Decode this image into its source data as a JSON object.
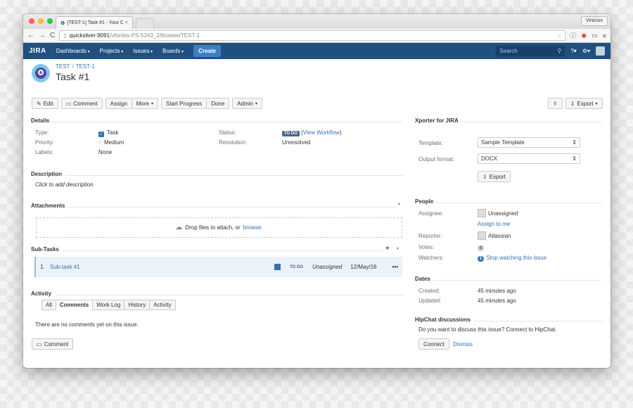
{
  "browser": {
    "tab_title": "[TEST-1] Task #1 - Your C",
    "user": "Vinicius",
    "url_host": "quicksilver:9091",
    "url_path": "/vfontes-PS-5243_2/browse/TEST-1"
  },
  "nav": {
    "logo": "JIRA",
    "items": [
      "Dashboards",
      "Projects",
      "Issues",
      "Boards"
    ],
    "create": "Create",
    "search_placeholder": "Search"
  },
  "issue": {
    "project": "TEST",
    "key": "TEST-1",
    "summary": "Task #1"
  },
  "actions": {
    "edit": "Edit",
    "comment": "Comment",
    "assign": "Assign",
    "more": "More",
    "start_progress": "Start Progress",
    "done": "Done",
    "admin": "Admin",
    "export": "Export"
  },
  "details": {
    "heading": "Details",
    "type_label": "Type:",
    "type_value": "Task",
    "priority_label": "Priority:",
    "priority_value": "Medium",
    "labels_label": "Labels:",
    "labels_value": "None",
    "status_label": "Status:",
    "status_value": "TO DO",
    "view_workflow": "View Workflow",
    "resolution_label": "Resolution:",
    "resolution_value": "Unresolved"
  },
  "description": {
    "heading": "Description",
    "placeholder": "Click to add description"
  },
  "attachments": {
    "heading": "Attachments",
    "drop_text": "Drop files to attach, or",
    "browse": "browse."
  },
  "subtasks": {
    "heading": "Sub-Tasks",
    "rows": [
      {
        "num": "1.",
        "title": "Sub-task #1",
        "status": "TO DO",
        "assignee": "Unassigned",
        "date": "12/May/16"
      }
    ]
  },
  "activity": {
    "heading": "Activity",
    "tabs": [
      "All",
      "Comments",
      "Work Log",
      "History",
      "Activity"
    ],
    "active_tab": "Comments",
    "empty": "There are no comments yet on this issue.",
    "comment_button": "Comment"
  },
  "xporter": {
    "heading": "Xporter for JIRA",
    "template_label": "Template:",
    "template_value": "Sample Template",
    "format_label": "Output format:",
    "format_value": "DOCX",
    "export": "Export"
  },
  "people": {
    "heading": "People",
    "assignee_label": "Assignee:",
    "assignee_value": "Unassigned",
    "assign_to_me": "Assign to me",
    "reporter_label": "Reporter:",
    "reporter_value": "Atlassian",
    "votes_label": "Votes:",
    "votes_value": "0",
    "watchers_label": "Watchers:",
    "watchers_count": "1",
    "stop_watching": "Stop watching this issue"
  },
  "dates": {
    "heading": "Dates",
    "created_label": "Created:",
    "created_value": "45 minutes ago",
    "updated_label": "Updated:",
    "updated_value": "45 minutes ago"
  },
  "hipchat": {
    "heading": "HipChat discussions",
    "text": "Do you want to discuss this issue? Connect to HipChat.",
    "connect": "Connect",
    "dismiss": "Dismiss"
  },
  "colors": {
    "nav_bg": "#205081",
    "link": "#3572b0",
    "create_btn": "#3b7fc4",
    "priority": "#f79232"
  }
}
